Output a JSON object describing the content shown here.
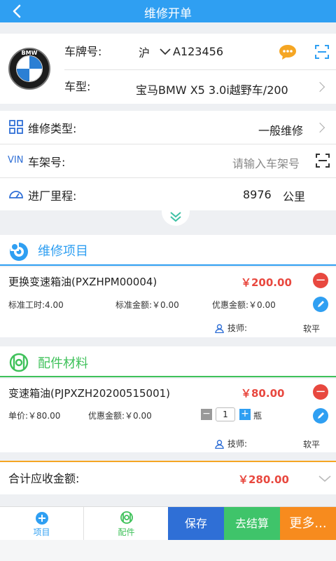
{
  "header": {
    "title": "维修开单"
  },
  "vehicle": {
    "logo_text": "BMW",
    "plate_label": "车牌号:",
    "plate_region": "沪",
    "plate_number": "A123456",
    "model_label": "车型:",
    "model_value": "宝马BMW X5 3.0i越野车/200"
  },
  "info": {
    "repair_type_label": "维修类型:",
    "repair_type_value": "一般维修",
    "vin_prefix": "VIN",
    "vin_label": "车架号:",
    "vin_placeholder": "请输入车架号",
    "mileage_label": "进厂里程:",
    "mileage_value": "8976",
    "mileage_unit": "公里"
  },
  "repair_items": {
    "title": "维修项目",
    "accent": "#2f9ff2",
    "item": {
      "name": "更换变速箱油(PXZHPM00004)",
      "price": "￥200.00",
      "std_hours": "标准工时:4.00",
      "std_amount": "标准金额:￥0.00",
      "discount": "优惠金额:￥0.00",
      "tech_label": "技师:",
      "tech_name": "软平"
    }
  },
  "parts": {
    "title": "配件材料",
    "accent": "#3fc15a",
    "item": {
      "name": "变速箱油(PJPXZH20200515001)",
      "price": "￥80.00",
      "unit_price": "单价:￥80.00",
      "discount": "优惠金额:￥0.00",
      "qty": "1",
      "unit": "瓶",
      "tech_label": "技师:",
      "tech_name": "软平"
    }
  },
  "total": {
    "label": "合计应收金额:",
    "value": "￥280.00",
    "accent": "#f5a623"
  },
  "tabbar": {
    "tab_items": "项目",
    "tab_parts": "配件",
    "save": "保存",
    "checkout": "去结算",
    "more": "更多..."
  },
  "colors": {
    "primary": "#2f9ff2",
    "save_btn": "#2f6fd6",
    "checkout_btn": "#3fc46a",
    "more_btn": "#f78b1e",
    "price": "#e8483f"
  }
}
